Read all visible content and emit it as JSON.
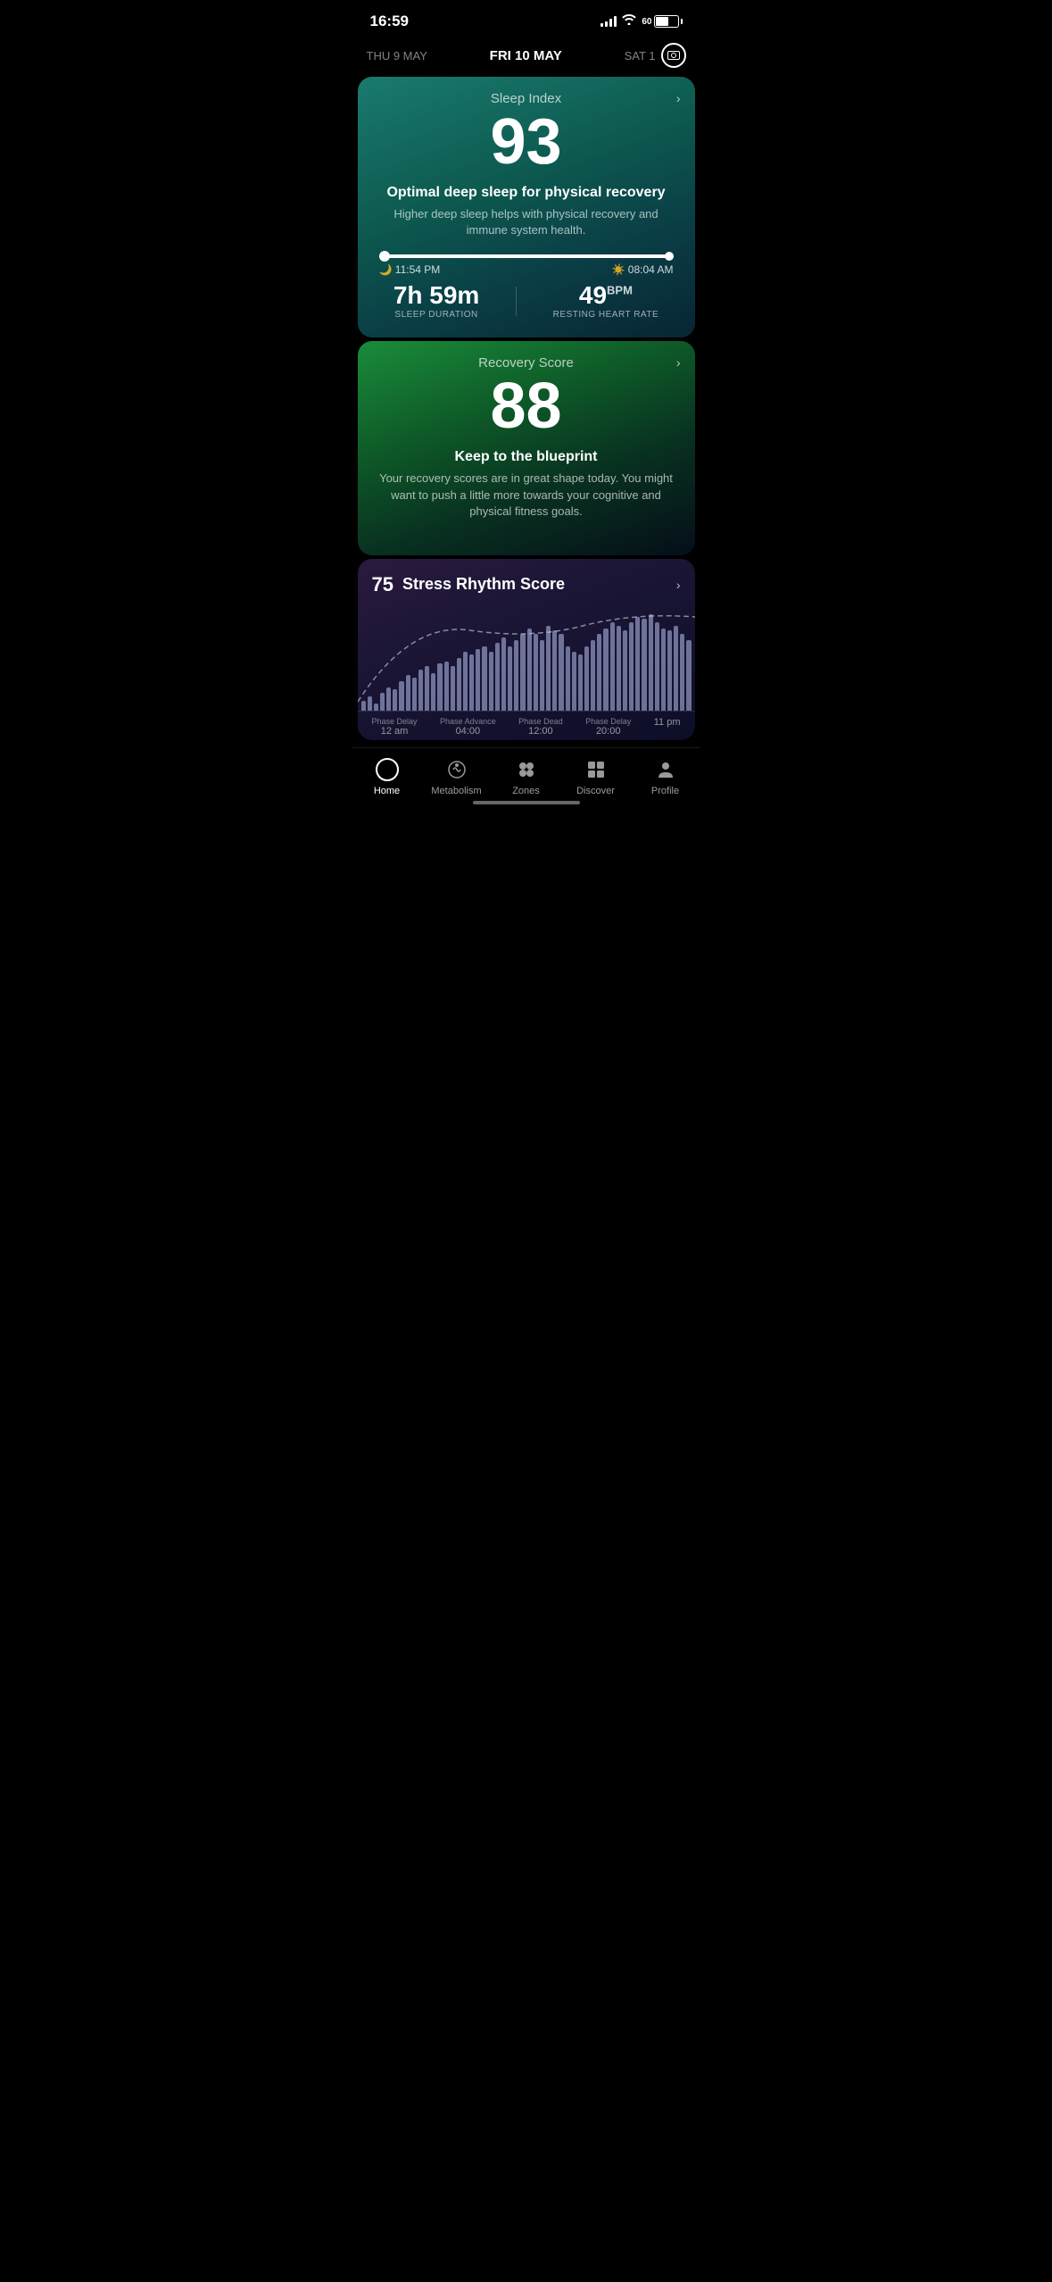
{
  "statusBar": {
    "time": "16:59",
    "battery": "60"
  },
  "dateNav": {
    "prev": "THU 9 MAY",
    "current": "FRI 10 MAY",
    "next": "SAT 1"
  },
  "sleepCard": {
    "title": "Sleep Index",
    "score": "93",
    "headline": "Optimal deep sleep for physical recovery",
    "description": "Higher deep sleep helps with physical recovery and immune system health.",
    "timeStart": "11:54 PM",
    "timeEnd": "08:04 AM",
    "duration": "7h 59m",
    "durationLabel": "SLEEP DURATION",
    "heartRate": "49",
    "heartRateUnit": "BPM",
    "heartRateLabel": "RESTING HEART RATE"
  },
  "recoveryCard": {
    "title": "Recovery Score",
    "score": "88",
    "headline": "Keep to the blueprint",
    "description": "Your recovery scores are in great shape today. You might want to push a little more towards your cognitive and physical fitness goals."
  },
  "stressCard": {
    "score": "75",
    "title": "Stress Rhythm Score",
    "phases": [
      {
        "label": "Phase Delay",
        "time": "12 am"
      },
      {
        "label": "Phase Advance",
        "time": "04:00"
      },
      {
        "label": "Phase Dead",
        "time": "12:00"
      },
      {
        "label": "Phase Delay",
        "time": "20:00"
      },
      {
        "label": "",
        "time": "11 pm"
      }
    ]
  },
  "bottomNav": {
    "items": [
      {
        "label": "Home",
        "icon": "home-icon",
        "active": true
      },
      {
        "label": "Metabolism",
        "icon": "metabolism-icon",
        "active": false
      },
      {
        "label": "Zones",
        "icon": "zones-icon",
        "active": false
      },
      {
        "label": "Discover",
        "icon": "discover-icon",
        "active": false
      },
      {
        "label": "Profile",
        "icon": "profile-icon",
        "active": false
      }
    ]
  },
  "chartBars": [
    8,
    12,
    6,
    15,
    20,
    18,
    25,
    30,
    28,
    35,
    38,
    32,
    40,
    42,
    38,
    45,
    50,
    48,
    52,
    55,
    50,
    58,
    62,
    55,
    60,
    65,
    70,
    65,
    60,
    72,
    68,
    65,
    55,
    50,
    48,
    55,
    60,
    65,
    70,
    75,
    72,
    68,
    75,
    80,
    78,
    82,
    75,
    70,
    68,
    72,
    65,
    60
  ]
}
